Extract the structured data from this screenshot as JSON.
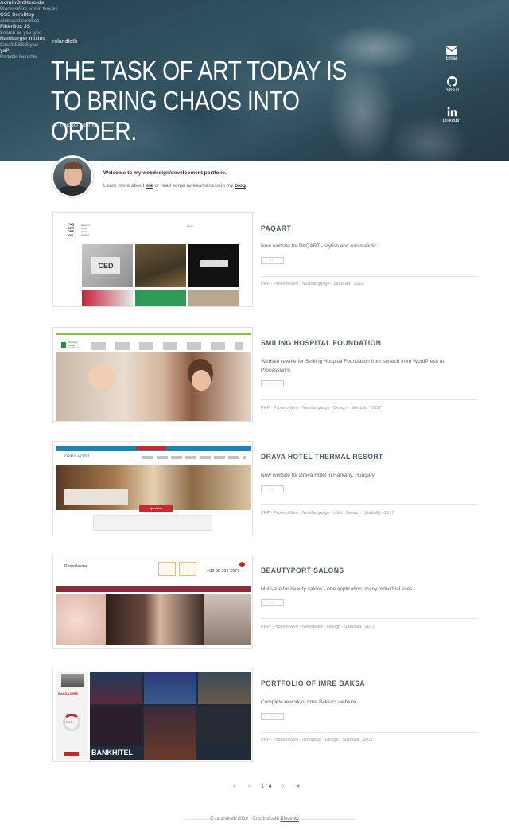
{
  "nav": [
    {
      "title": "AdminOnSteroids",
      "sub": "ProcessWire admin tweaks"
    },
    {
      "title": "CSS Scrolltop",
      "sub": "Animated scrolltop"
    },
    {
      "title": "FilterBox JS",
      "sub": "Search-as-you-type"
    },
    {
      "title": "Hamburger mixins",
      "sub": "Sass/LESS/Stylus"
    },
    {
      "title": "yaP",
      "sub": "Portable launcher"
    }
  ],
  "site_name": "rolandtoth",
  "quote": "THE TASK OF ART TODAY IS TO BRING CHAOS INTO ORDER.",
  "quote_author": "— Theodor Adorno",
  "social": [
    {
      "label": "Email",
      "icon": "envelope-icon"
    },
    {
      "label": "GitHub",
      "icon": "github-icon"
    },
    {
      "label": "LinkedIn",
      "icon": "linkedin-icon"
    }
  ],
  "intro": {
    "welcome": "Welcome to my webdesign/development portfolio.",
    "pre": "Learn more about ",
    "me": "me",
    "mid": " or read some awesomeness in my ",
    "blog": "blog",
    "post": "."
  },
  "projects": [
    {
      "title": "PAQART",
      "desc": "New website for PAQART - stylish and minimalistic.",
      "button": "···",
      "tags": "PHP · ProcessWire · Multilanguage · Sitebuild · 2018"
    },
    {
      "title": "SMILING HOSPITAL FOUNDATION",
      "desc": "Website rewrite for Smiling Hospital Foundation from scratch from WordPress to ProcessWire.",
      "button": "···",
      "tags": "PHP · ProcessWire · Multilanguage · Design · Sitebuild · 2017"
    },
    {
      "title": "DRAVA HOTEL THERMAL RESORT",
      "desc": "New website for Drava Hotel in Harkány, Hungary.",
      "button": "···",
      "tags": "PHP · ProcessWire · Multilanguage · UIkit · Design · Sitebuild · 2017"
    },
    {
      "title": "BEAUTYPORT SALONS",
      "desc": "Multi-site for beauty salons - one application, many individual sites.",
      "button": "···",
      "tags": "PHP · ProcessWire · Newsletter · Design · Sitebuild · 2017"
    },
    {
      "title": "PORTFOLIO OF IMRE BAKSA",
      "desc": "Complete rework of Imre Baksa's website.",
      "button": "···",
      "tags": "PHP · ProcessWire · Isotope.js · Design · Sitebuild · 2017"
    }
  ],
  "thumbs": {
    "paqart_logo": "PAQ ART DES IGN",
    "paqart_menu": "about us\nworks\nclients\ncontact",
    "paqart_lang": "hu   en",
    "smiling_logo": "Mosolygó Kórház Alapítvány",
    "drava_logo": "DRÁVA HOTEL",
    "drava_cta": "Ajánlatok",
    "beauty_title": "Dermolasma",
    "beauty_phone": "+36 30 312 2077",
    "baksa_name": "BAKSA IMRE",
    "baksa_pct": "2015",
    "baksa_bank": "BANKHITEL"
  },
  "pagination": {
    "first": "«",
    "prev": "‹",
    "current": "1 / 4",
    "next": "›",
    "last": "»"
  },
  "footer": {
    "pre": "© rolandtoth 2018 · Created with ",
    "link": "Eleventy"
  }
}
